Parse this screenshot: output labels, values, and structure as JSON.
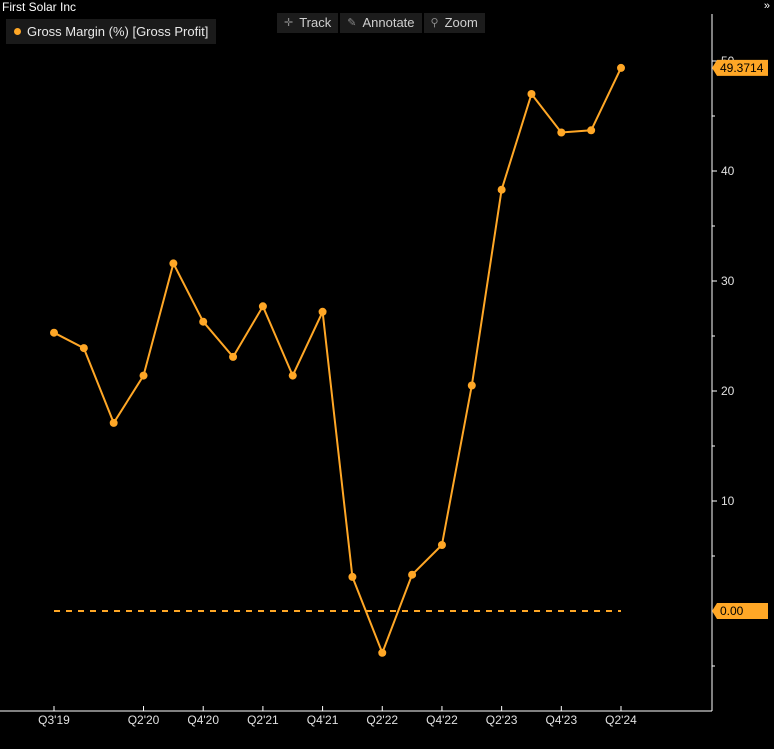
{
  "window": {
    "title": "First Solar Inc"
  },
  "toolbar": {
    "track": "Track",
    "annotate": "Annotate",
    "zoom": "Zoom"
  },
  "legend": {
    "label": "Gross Margin (%) [Gross Profit]"
  },
  "colors": {
    "series": "#ffa726",
    "background": "#000000",
    "axis": "#ffffff",
    "grid": "#333333"
  },
  "chart_data": {
    "type": "line",
    "title": "",
    "xlabel": "",
    "ylabel": "",
    "ylim": [
      -7,
      55
    ],
    "yticks": [
      10,
      20,
      30,
      40,
      50
    ],
    "x_tick_labels": [
      "Q3'19",
      "Q2'20",
      "Q4'20",
      "Q2'21",
      "Q4'21",
      "Q2'22",
      "Q4'22",
      "Q2'23",
      "Q4'23",
      "Q2'24"
    ],
    "x_tick_indices": [
      0,
      3,
      5,
      7,
      9,
      11,
      13,
      15,
      17,
      19
    ],
    "x": [
      "Q3'19",
      "Q4'19",
      "Q1'20",
      "Q2'20",
      "Q3'20",
      "Q4'20",
      "Q1'21",
      "Q2'21",
      "Q3'21",
      "Q4'21",
      "Q1'22",
      "Q2'22",
      "Q3'22",
      "Q4'22",
      "Q1'23",
      "Q2'23",
      "Q3'23",
      "Q4'23",
      "Q1'24",
      "Q2'24"
    ],
    "series": [
      {
        "values": [
          25.3,
          23.9,
          17.1,
          21.4,
          31.6,
          26.3,
          23.1,
          27.7,
          21.4,
          27.2,
          3.1,
          -3.8,
          3.3,
          6.0,
          20.5,
          38.3,
          47.0,
          43.5,
          43.7,
          49.3714
        ]
      }
    ],
    "reference_line": {
      "value": 0,
      "label": "0.00"
    },
    "last_value_label": "49.3714",
    "grid": false,
    "legend_position": "top-left"
  }
}
